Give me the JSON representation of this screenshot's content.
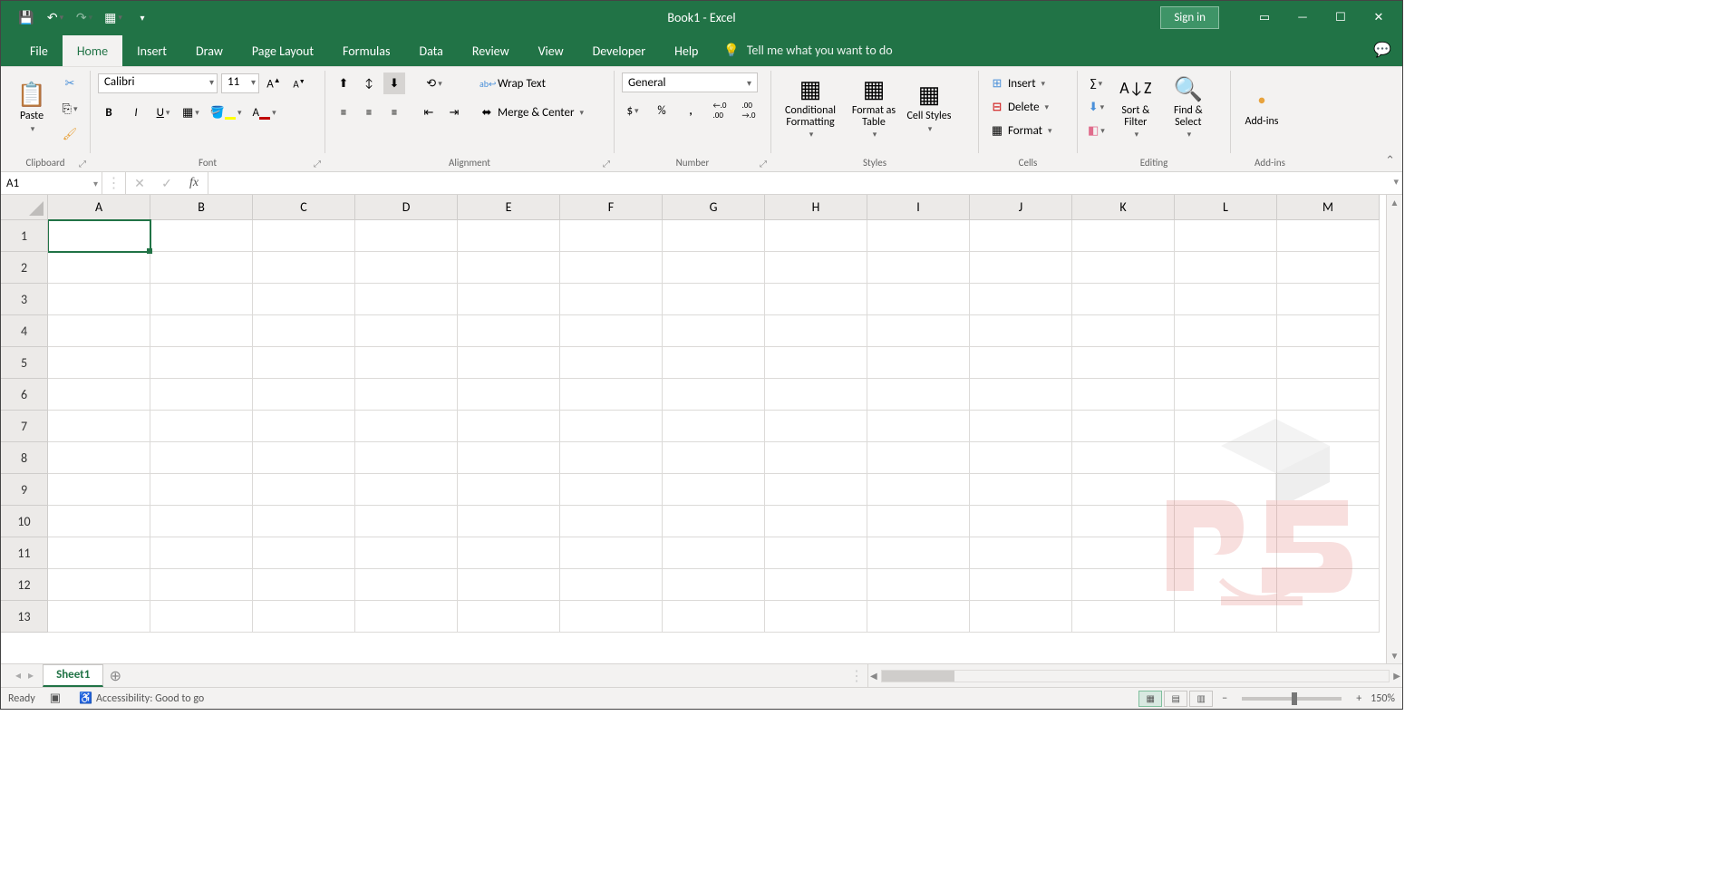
{
  "title": "Book1  -  Excel",
  "signin_label": "Sign in",
  "tabs": {
    "file": "File",
    "home": "Home",
    "insert": "Insert",
    "draw": "Draw",
    "page_layout": "Page Layout",
    "formulas": "Formulas",
    "data": "Data",
    "review": "Review",
    "view": "View",
    "developer": "Developer",
    "help": "Help"
  },
  "tellme": "Tell me what you want to do",
  "ribbon": {
    "clipboard": {
      "label": "Clipboard",
      "paste": "Paste"
    },
    "font": {
      "label": "Font",
      "name": "Calibri",
      "size": "11"
    },
    "alignment": {
      "label": "Alignment",
      "wrap": "Wrap Text",
      "merge": "Merge & Center"
    },
    "number": {
      "label": "Number",
      "format": "General"
    },
    "styles": {
      "label": "Styles",
      "cond": "Conditional Formatting",
      "table": "Format as Table",
      "cell": "Cell Styles"
    },
    "cells": {
      "label": "Cells",
      "insert": "Insert",
      "delete": "Delete",
      "format": "Format"
    },
    "editing": {
      "label": "Editing",
      "sort": "Sort & Filter",
      "find": "Find & Select"
    },
    "addins": {
      "label": "Add-ins",
      "btn": "Add-ins"
    }
  },
  "namebox": "A1",
  "grid": {
    "cols": [
      "A",
      "B",
      "C",
      "D",
      "E",
      "F",
      "G",
      "H",
      "I",
      "J",
      "K",
      "L",
      "M"
    ],
    "rows": [
      "1",
      "2",
      "3",
      "4",
      "5",
      "6",
      "7",
      "8",
      "9",
      "10",
      "11",
      "12",
      "13"
    ]
  },
  "sheet_tab": "Sheet1",
  "status": {
    "ready": "Ready",
    "a11y": "Accessibility: Good to go",
    "zoom": "150%"
  }
}
